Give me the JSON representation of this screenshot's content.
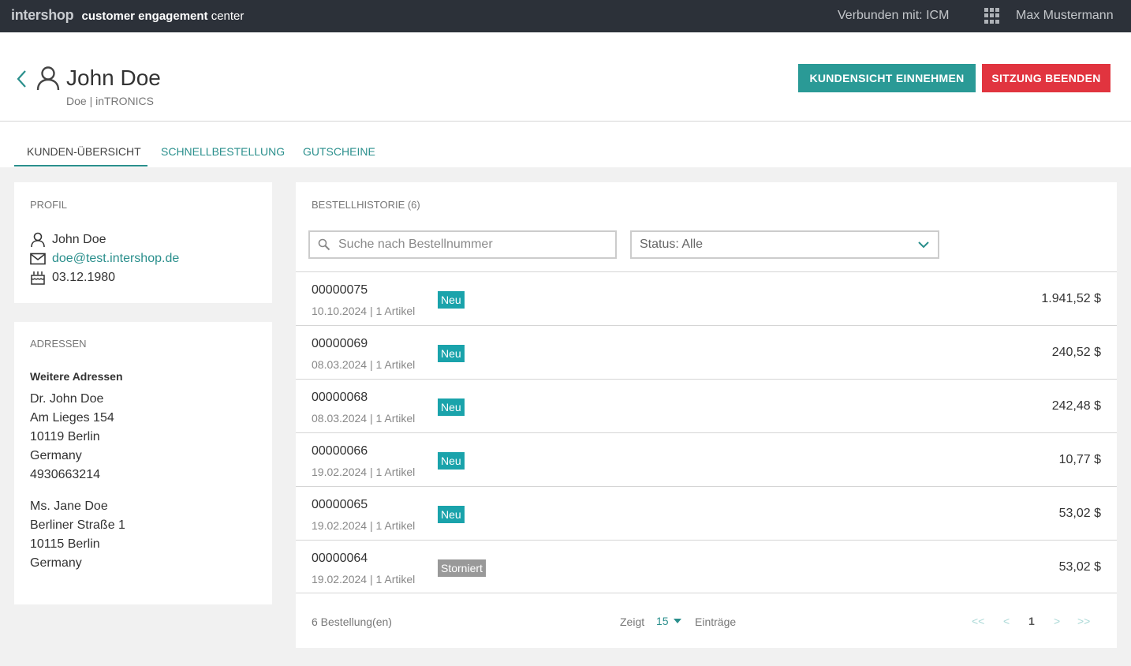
{
  "topbar": {
    "brand_logo": "intershop",
    "brand_bold": "customer engagement",
    "brand_rest": "center",
    "connected": "Verbunden mit: ICM",
    "user": "Max Mustermann"
  },
  "header": {
    "customer_name": "John Doe",
    "customer_sub": "Doe | inTRONICS",
    "btn_impersonate": "KUNDENSICHT EINNEHMEN",
    "btn_end_session": "SITZUNG BEENDEN"
  },
  "tabs": [
    "KUNDEN-ÜBERSICHT",
    "SCHNELLBESTELLUNG",
    "GUTSCHEINE"
  ],
  "profile": {
    "title": "PROFIL",
    "name": "John Doe",
    "email": "doe@test.intershop.de",
    "birthday": "03.12.1980"
  },
  "addresses": {
    "title": "ADRESSEN",
    "heading": "Weitere Adressen",
    "list": [
      [
        "Dr. John Doe",
        "Am Lieges 154",
        "10119 Berlin",
        "Germany",
        "4930663214"
      ],
      [
        "Ms. Jane Doe",
        "Berliner Straße 1",
        "10115 Berlin",
        "Germany"
      ]
    ]
  },
  "orders": {
    "title": "BESTELLHISTORIE (6)",
    "search_placeholder": "Suche nach Bestellnummer",
    "status_value": "Status: Alle",
    "rows": [
      {
        "number": "00000075",
        "meta": "10.10.2024 | 1 Artikel",
        "status": "Neu",
        "price": "1.941,52 $"
      },
      {
        "number": "00000069",
        "meta": "08.03.2024 | 1 Artikel",
        "status": "Neu",
        "price": "240,52 $"
      },
      {
        "number": "00000068",
        "meta": "08.03.2024 | 1 Artikel",
        "status": "Neu",
        "price": "242,48 $"
      },
      {
        "number": "00000066",
        "meta": "19.02.2024 | 1 Artikel",
        "status": "Neu",
        "price": "10,77 $"
      },
      {
        "number": "00000065",
        "meta": "19.02.2024 | 1 Artikel",
        "status": "Neu",
        "price": "53,02 $"
      },
      {
        "number": "00000064",
        "meta": "19.02.2024 | 1 Artikel",
        "status": "Storniert",
        "price": "53,02 $"
      }
    ],
    "footer": {
      "count": "6 Bestellung(en)",
      "show": "Zeigt",
      "per_page": "15",
      "entries": "Einträge",
      "pager": [
        "<<",
        "<",
        "1",
        ">",
        ">>"
      ]
    }
  },
  "colors": {
    "topbar": "#2c3139",
    "accent": "#2a9a96",
    "danger": "#e1343f",
    "badge_new": "#1aa3ab",
    "badge_cancelled": "#999999"
  }
}
